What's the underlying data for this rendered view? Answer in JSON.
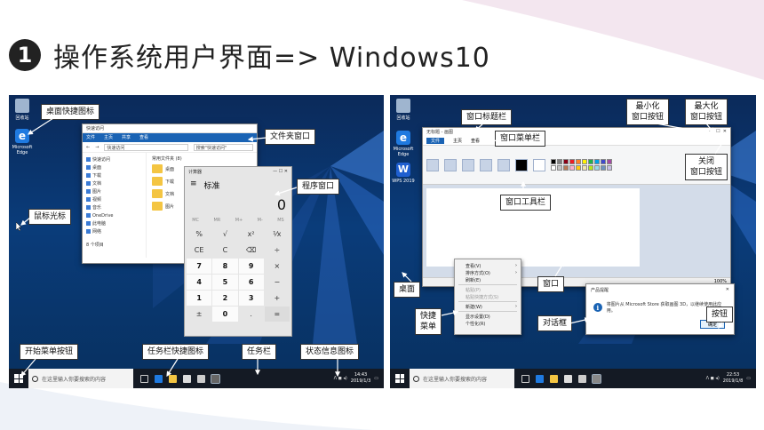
{
  "heading": {
    "number": "1",
    "text": "操作系统用户界面=> Windows10"
  },
  "left": {
    "desktop_icons": [
      {
        "label": "回收站"
      },
      {
        "label": "Microsoft Edge"
      }
    ],
    "explorer": {
      "title": "文件夹窗口",
      "tabs": [
        "文件",
        "主页",
        "共享",
        "查看"
      ],
      "address": "快速访问",
      "search": "搜索\"快速访问\"",
      "nav": [
        "快速访问",
        "桌面",
        "下载",
        "文档",
        "图片",
        "视频",
        "音乐",
        "OneDrive",
        "此电脑",
        "网络"
      ],
      "section": "常用文件夹 (8)",
      "files": [
        "桌面",
        "下载",
        "文档",
        "图片"
      ],
      "status": "8 个项目"
    },
    "calculator": {
      "title": "计算器",
      "mode": "标准",
      "display": "0",
      "memory": [
        "MC",
        "MR",
        "M+",
        "M-",
        "MS"
      ],
      "keys": [
        "%",
        "√",
        "x²",
        "⅟x",
        "CE",
        "C",
        "⌫",
        "÷",
        "7",
        "8",
        "9",
        "×",
        "4",
        "5",
        "6",
        "−",
        "1",
        "2",
        "3",
        "+",
        "±",
        "0",
        ".",
        "="
      ]
    },
    "taskbar": {
      "search": "在这里输入你要搜索的内容",
      "time": "14:43",
      "date": "2019/1/3"
    },
    "labels": {
      "desktop_icon": "桌面快捷图标",
      "folder_window": "文件夹窗口",
      "program_window": "程序窗口",
      "mouse_cursor": "鼠标光标",
      "start_button": "开始菜单按钮",
      "taskbar_shortcut": "任务栏快捷图标",
      "taskbar": "任务栏",
      "status_icons": "状态信息图标"
    }
  },
  "right": {
    "desktop_icons": [
      {
        "label": "回收站"
      },
      {
        "label": "Microsoft Edge"
      },
      {
        "label": "WPS 2019"
      }
    ],
    "paint": {
      "title": "无标题 - 画图",
      "tabs": [
        "文件",
        "主页",
        "查看"
      ],
      "groups": [
        "剪贴板",
        "图像",
        "工具",
        "形状",
        "颜色"
      ],
      "zoom": "100%"
    },
    "context_menu": {
      "items": [
        "查看(V)",
        "排序方式(O)",
        "刷新(E)",
        "粘贴(P)",
        "粘贴快捷方式(S)",
        "新建(W)",
        "显示设置(D)",
        "个性化(R)"
      ]
    },
    "dialog": {
      "title": "产品提醒",
      "message": "将图片从 Microsoft Store 获取画图 3D，以继续使用此应用。",
      "ok": "确定"
    },
    "taskbar": {
      "search": "在这里输入你要搜索的内容",
      "time": "22:53",
      "date": "2019/1/8"
    },
    "labels": {
      "title_bar": "窗口标题栏",
      "minimize": "最小化\n窗口按钮",
      "maximize": "最大化\n窗口按钮",
      "menu_bar": "窗口菜单栏",
      "close": "关闭\n窗口按钮",
      "toolbar": "窗口工具栏",
      "desktop": "桌面",
      "window": "窗口",
      "quick_menu": "快捷\n菜单",
      "dialog": "对话框",
      "button": "按钮"
    }
  }
}
